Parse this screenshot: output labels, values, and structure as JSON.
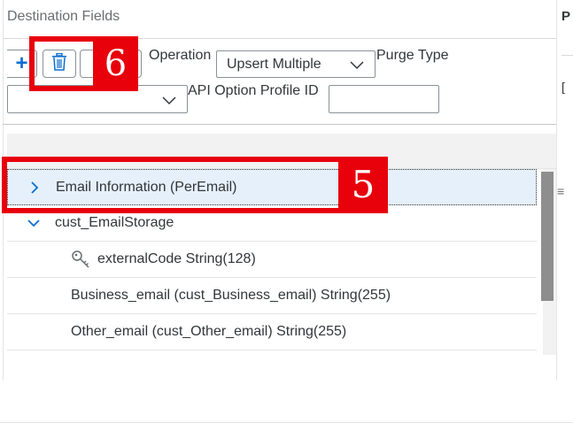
{
  "panel": {
    "title": "Destination Fields"
  },
  "right_peek": {
    "title": "P",
    "glyph": "["
  },
  "toolbar": {
    "add_icon": "plus-icon",
    "delete_icon": "trash-icon",
    "more_icon": "chevron-down-icon"
  },
  "operation": {
    "label": "Operation",
    "selected": "Upsert Multiple"
  },
  "purge": {
    "label": "Purge Type",
    "selected": ""
  },
  "api_option": {
    "label": "API Option Profile ID",
    "value": ""
  },
  "tree": {
    "rows": [
      {
        "label": "Email Information (PerEmail)",
        "state": "collapsed",
        "selected": true
      },
      {
        "label": "cust_EmailStorage",
        "state": "expanded",
        "selected": false
      },
      {
        "label": "externalCode String(128)",
        "icon": "key-icon",
        "selected": false
      },
      {
        "label": "Business_email (cust_Business_email) String(255)",
        "selected": false
      },
      {
        "label": "Other_email (cust_Other_email) String(255)",
        "selected": false
      }
    ]
  },
  "side_grip": "≡",
  "annotations": [
    {
      "number": "6",
      "color": "#e8000b"
    },
    {
      "number": "5",
      "color": "#e8000b"
    }
  ],
  "colors": {
    "accent": "#0a6ed1",
    "selection": "#e5f0fa",
    "annotation": "#e8000b"
  }
}
